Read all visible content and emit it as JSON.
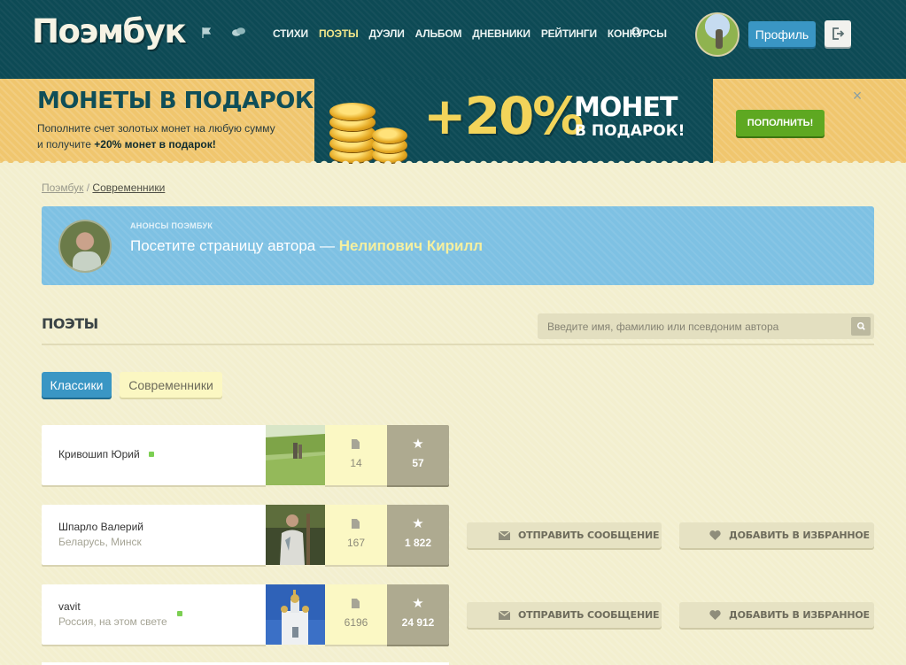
{
  "header": {
    "logo": "Поэмбук",
    "nav": [
      "СТИХИ",
      "ПОЭТЫ",
      "ДУЭЛИ",
      "АЛЬБОМ",
      "ДНЕВНИКИ",
      "РЕЙТИНГИ",
      "КОНКУРСЫ"
    ],
    "active_nav": "ПОЭТЫ",
    "profile_label": "Профиль"
  },
  "promo": {
    "title": "МОНЕТЫ В ПОДАРОК!",
    "text_line1": "Пополните счет золотых монет на любую сумму",
    "text_line2_prefix": "и получите ",
    "text_line2_bold": "+20% монет в подарок!",
    "big_percent": "+20%",
    "coins_line1": "МОНЕТ",
    "coins_line2": "В ПОДАРОК!",
    "button_label": "ПОПОЛНИТЬ!",
    "close_symbol": "×"
  },
  "breadcrumb": {
    "root": "Поэмбук",
    "separator": " / ",
    "current": "Современники"
  },
  "announce": {
    "label": "АНОНСЫ ПОЭМБУК",
    "text_prefix": "Посетите страницу автора — ",
    "author": "Нелипович Кирилл"
  },
  "poets": {
    "title": "ПОЭТЫ",
    "search_placeholder": "Введите имя, фамилию или псевдоним автора",
    "tabs": {
      "classics": "Классики",
      "modern": "Современники"
    },
    "actions": {
      "message": "ОТПРАВИТЬ СООБЩЕНИЕ",
      "favorite": "ДОБАВИТЬ В ИЗБРАННОЕ"
    },
    "rows": [
      {
        "name": "Кривошип Юрий",
        "location": "",
        "online": true,
        "works": "14",
        "rating": "57"
      },
      {
        "name": "Шпарло Валерий",
        "location": "Беларусь, Минск",
        "online": false,
        "works": "167",
        "rating": "1 822"
      },
      {
        "name": "vavit",
        "location": "Россия, на этом свете",
        "online": true,
        "works": "6196",
        "rating": "24 912"
      }
    ]
  },
  "colors": {
    "header_bg": "#0d4a55",
    "page_bg": "#f3efcf",
    "accent_blue": "#3a96c4",
    "accent_green": "#5ea821",
    "promo_yellow": "#f0c66e",
    "announce_blue": "#7ec1e3"
  }
}
